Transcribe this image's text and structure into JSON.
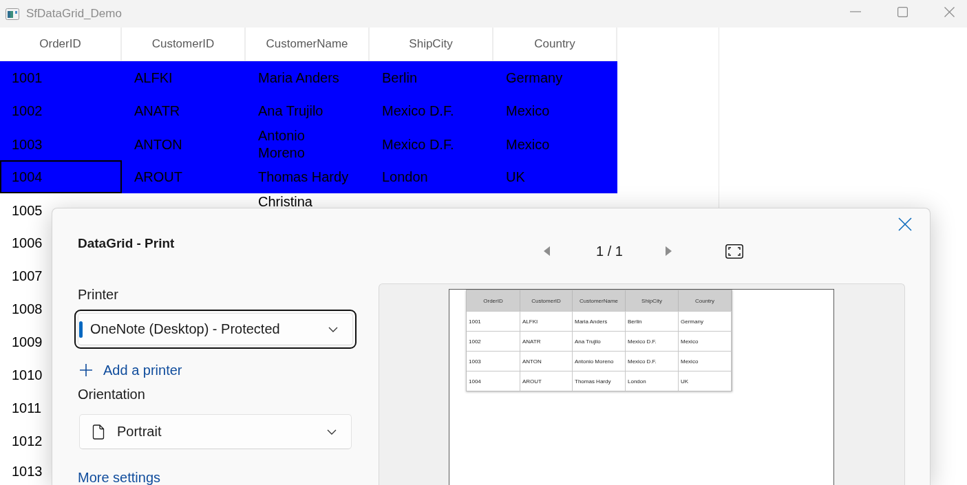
{
  "window": {
    "title": "SfDataGrid_Demo"
  },
  "grid": {
    "columns": [
      "OrderID",
      "CustomerID",
      "CustomerName",
      "ShipCity",
      "Country"
    ],
    "rows": [
      {
        "order_id": "1001",
        "customer_id": "ALFKI",
        "customer_name": "Maria Anders",
        "ship_city": "Berlin",
        "country": "Germany",
        "name_wrapped": false,
        "selected": true,
        "current": false
      },
      {
        "order_id": "1002",
        "customer_id": "ANATR",
        "customer_name": "Ana Trujilo",
        "ship_city": "Mexico D.F.",
        "country": "Mexico",
        "name_wrapped": false,
        "selected": true,
        "current": false
      },
      {
        "order_id": "1003",
        "customer_id": "ANTON",
        "customer_name": "Antonio Moreno",
        "ship_city": "Mexico D.F.",
        "country": "Mexico",
        "name_wrapped": true,
        "selected": true,
        "current": false
      },
      {
        "order_id": "1004",
        "customer_id": "AROUT",
        "customer_name": "Thomas Hardy",
        "ship_city": "London",
        "country": "UK",
        "name_wrapped": false,
        "selected": true,
        "current": true
      },
      {
        "order_id": "1005",
        "customer_name": "Christina",
        "name_wrapped": true,
        "selected": false,
        "current": false
      },
      {
        "order_id": "1006",
        "selected": false,
        "current": false
      },
      {
        "order_id": "1007",
        "selected": false,
        "current": false
      },
      {
        "order_id": "1008",
        "selected": false,
        "current": false
      },
      {
        "order_id": "1009",
        "selected": false,
        "current": false
      },
      {
        "order_id": "1010",
        "selected": false,
        "current": false
      },
      {
        "order_id": "1011",
        "selected": false,
        "current": false
      },
      {
        "order_id": "1012",
        "selected": false,
        "current": false
      },
      {
        "order_id": "1013",
        "selected": false,
        "current": false
      }
    ]
  },
  "dialog": {
    "title": "DataGrid - Print",
    "previous_page": {
      "disabled": true
    },
    "page_indicator": "1 / 1",
    "next_page": {
      "disabled": true
    },
    "printer": {
      "label": "Printer",
      "value": "OneNote (Desktop) - Protected",
      "focused": true
    },
    "add_printer": "Add a printer",
    "orientation": {
      "label": "Orientation",
      "value": "Portrait",
      "focused": false
    },
    "more_settings": "More settings",
    "preview": {
      "columns": [
        "OrderID",
        "CustomerID",
        "CustomerName",
        "ShipCity",
        "Country"
      ],
      "rows": [
        [
          "1001",
          "ALFKI",
          "Maria Anders",
          "Berlin",
          "Germany"
        ],
        [
          "1002",
          "ANATR",
          "Ana Trujilo",
          "Mexico D.F.",
          "Mexico"
        ],
        [
          "1003",
          "ANTON",
          "Antonio Moreno",
          "Mexico D.F.",
          "Mexico"
        ],
        [
          "1004",
          "AROUT",
          "Thomas Hardy",
          "London",
          "UK"
        ]
      ]
    }
  }
}
